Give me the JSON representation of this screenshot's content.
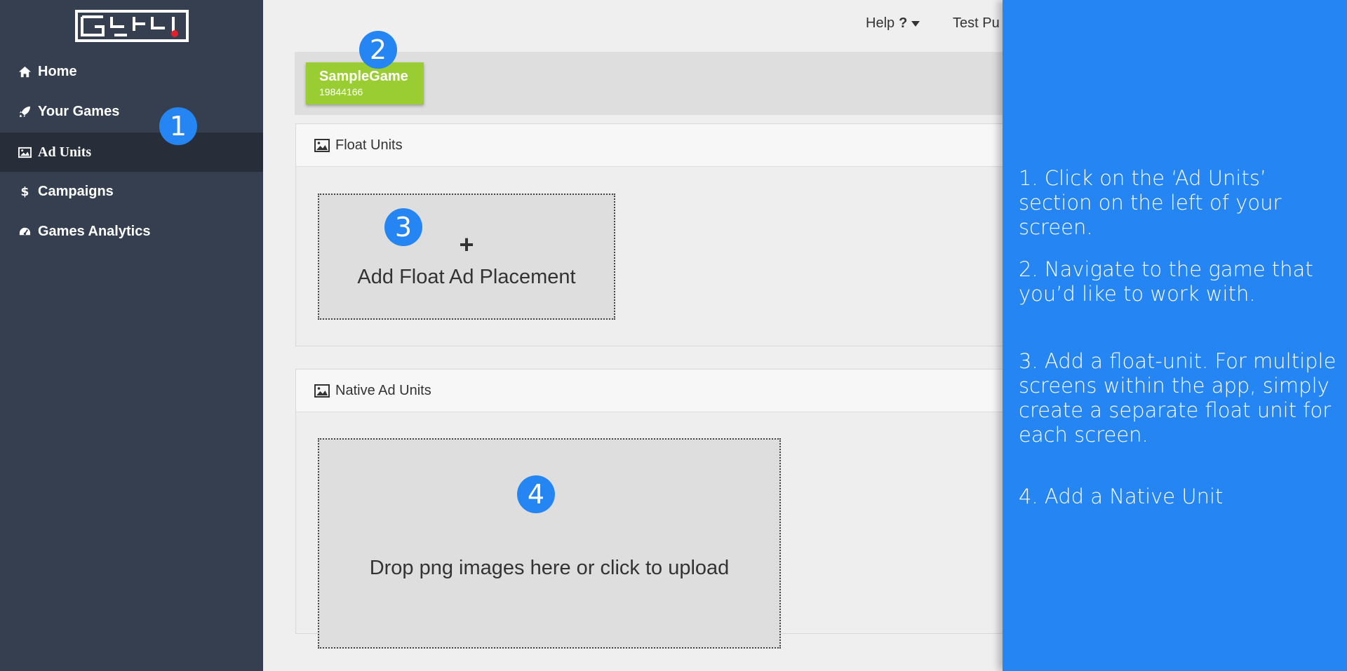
{
  "brand": {
    "logo_alt": "GreedyGame"
  },
  "sidebar": {
    "items": [
      {
        "label": "Home",
        "icon": "home-icon"
      },
      {
        "label": "Your Games",
        "icon": "rocket-icon"
      },
      {
        "label": "Ad Units",
        "icon": "image-icon",
        "active": true
      },
      {
        "label": "Campaigns",
        "icon": "dollar-icon"
      },
      {
        "label": "Games Analytics",
        "icon": "dashboard-icon"
      }
    ]
  },
  "topbar": {
    "help_label": "Help",
    "help_icon": "?",
    "user_label": "Test Pu"
  },
  "game": {
    "name": "SampleGame",
    "id": "19844166"
  },
  "float_units": {
    "title": "Float Units",
    "add_symbol": "+",
    "add_label": "Add Float Ad Placement"
  },
  "native_units": {
    "title": "Native Ad Units",
    "drop_label": "Drop png images here or click to upload"
  },
  "steps": [
    "1",
    "2",
    "3",
    "4"
  ],
  "instructions": [
    "1. Click on the ‘Ad Units’ section on the left of your screen.",
    "2. Navigate to the game that you’d like to work with.",
    "3. Add a float-unit. For multiple screens within the app, simply create a separate float unit for each screen.",
    "4. Add a Native Unit"
  ],
  "colors": {
    "sidebar_bg": "#353f50",
    "sidebar_active": "#272e3a",
    "accent_blue": "#2585f2",
    "game_tile": "#9acd32"
  }
}
